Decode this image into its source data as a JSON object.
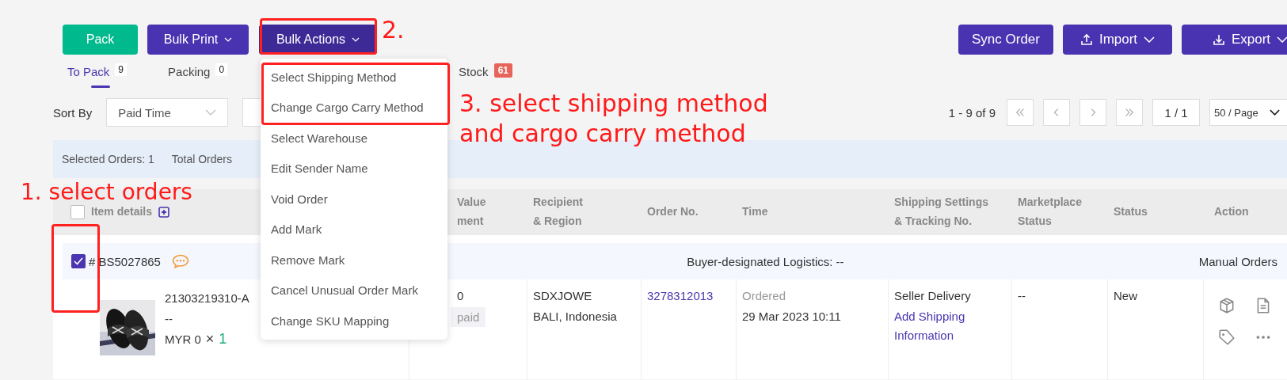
{
  "toolbar": {
    "left_buttons": [
      {
        "label": "Pack",
        "kind": "primary",
        "dropdown": false
      },
      {
        "label": "Bulk Print",
        "kind": "accent",
        "dropdown": true
      },
      {
        "label": "Bulk Actions",
        "kind": "dark",
        "dropdown": true
      }
    ],
    "right_buttons": [
      {
        "label": "Sync Order",
        "kind": "plain",
        "dropdown": false
      },
      {
        "label": "Import",
        "kind": "upload",
        "dropdown": true
      },
      {
        "label": "Export",
        "kind": "download",
        "dropdown": true
      }
    ]
  },
  "tabs": [
    {
      "label": "To Pack",
      "count": "9",
      "selected": true,
      "alert": false
    },
    {
      "label": "Packing",
      "count": "0",
      "selected": false,
      "alert": false
    },
    {
      "label": "Stock",
      "count": "61",
      "selected": false,
      "alert": true
    }
  ],
  "sort": {
    "label": "Sort By",
    "value": "Paid Time"
  },
  "pagination": {
    "range": "1 - 9 of 9",
    "page": "1 / 1",
    "page_size": "50 / Page"
  },
  "summary": {
    "selected": "Selected Orders: 1",
    "total": "Total Orders"
  },
  "table": {
    "header_checked": false,
    "columns": [
      {
        "lines": [
          "Item details"
        ]
      },
      {
        "lines": [
          "Value",
          "ment"
        ]
      },
      {
        "lines": [
          "Recipient",
          "& Region"
        ]
      },
      {
        "lines": [
          "Order No."
        ]
      },
      {
        "lines": [
          "Time"
        ]
      },
      {
        "lines": [
          "Shipping Settings",
          "& Tracking No."
        ]
      },
      {
        "lines": [
          "Marketplace",
          "Status"
        ]
      },
      {
        "lines": [
          "Status"
        ]
      },
      {
        "lines": [
          "Action"
        ]
      }
    ],
    "orders": [
      {
        "checked": true,
        "number": "# BS5027865",
        "logistics": "Buyer-designated Logistics: --",
        "source": "Manual Orders",
        "item": {
          "sku": "21303219310-A",
          "variant": "--",
          "price": "MYR 0",
          "times": "×",
          "qty": "1"
        },
        "value": "0",
        "payment": "paid",
        "recipient": "SDXJOWE",
        "region": "BALI, Indonesia",
        "order_no": "3278312013",
        "time_label": "Ordered",
        "time": "29 Mar 2023 10:11",
        "shipping": "Seller Delivery",
        "shipping_link": "Add Shipping Information",
        "marketplace_status": "--",
        "status": "New"
      }
    ]
  },
  "menu": {
    "items": [
      {
        "label": "Select Shipping Method"
      },
      {
        "label": "Change Cargo Carry Method"
      },
      {
        "label": "Select Warehouse"
      },
      {
        "label": "Edit Sender Name"
      },
      {
        "label": "Void Order"
      },
      {
        "label": "Add Mark"
      },
      {
        "label": "Remove Mark"
      },
      {
        "label": "Cancel Unusual Order Mark"
      },
      {
        "label": "Change SKU Mapping"
      }
    ]
  },
  "annotations": [
    {
      "kind": "box"
    },
    {
      "kind": "text",
      "lines": [
        "2."
      ]
    },
    {
      "kind": "box"
    },
    {
      "kind": "text",
      "lines": [
        "3. select shipping method",
        "and cargo carry method"
      ]
    },
    {
      "kind": "text",
      "lines": [
        "1. select orders"
      ]
    },
    {
      "kind": "box"
    }
  ]
}
